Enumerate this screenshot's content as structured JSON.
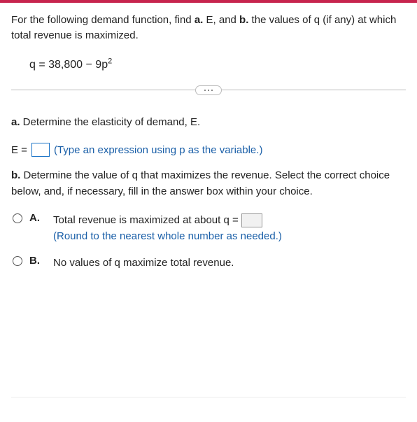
{
  "question": {
    "intro_prefix": "For the following demand function, find ",
    "bold_a": "a.",
    "mid1": " E, and ",
    "bold_b": "b.",
    "mid2": " the values of q (if any) at which total revenue is maximized.",
    "equation_prefix": "q = 38,800 − 9p",
    "equation_exp": "2"
  },
  "part_a": {
    "bold": "a.",
    "text": " Determine the elasticity of demand, E.",
    "lhs": "E =",
    "hint": "(Type an expression using p as the variable.)"
  },
  "part_b": {
    "bold": "b.",
    "text": " Determine the value of q that maximizes the revenue. Select the correct choice below, and, if necessary, fill in the answer box within your choice."
  },
  "choices": {
    "a": {
      "label": "A.",
      "text_before": "Total revenue is maximized at about q =",
      "hint": "(Round to the nearest whole number as needed.)"
    },
    "b": {
      "label": "B.",
      "text": "No values of q maximize total revenue."
    }
  }
}
